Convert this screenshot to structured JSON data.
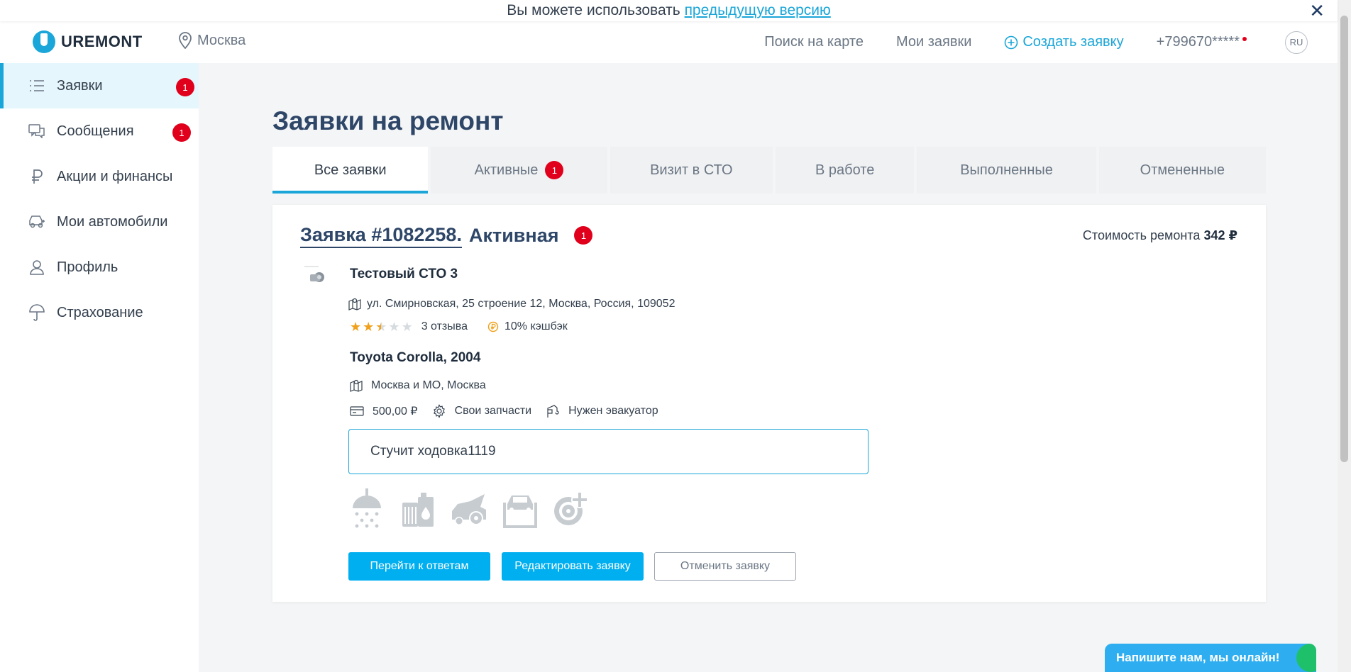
{
  "notice": {
    "text": "Вы можете использовать ",
    "link": "предыдущую версию",
    "close_icon": "close-icon"
  },
  "header": {
    "logo_text": "UREMONT",
    "city": "Москва",
    "nav": {
      "map": "Поиск на карте",
      "my_orders": "Мои заявки",
      "create": "Создать заявку",
      "phone": "+799670*****",
      "lang": "RU"
    }
  },
  "sidebar": {
    "items": [
      {
        "label": "Заявки",
        "icon": "list-icon",
        "badge": "1",
        "active": true
      },
      {
        "label": "Сообщения",
        "icon": "chat-icon",
        "badge": "1"
      },
      {
        "label": "Акции и финансы",
        "icon": "ruble-icon"
      },
      {
        "label": "Мои автомобили",
        "icon": "car-icon"
      },
      {
        "label": "Профиль",
        "icon": "user-icon"
      },
      {
        "label": "Страхование",
        "icon": "umbrella-icon"
      }
    ]
  },
  "main": {
    "title": "Заявки на ремонт",
    "tabs": [
      {
        "label": "Все заявки",
        "active": true
      },
      {
        "label": "Активные",
        "badge": "1"
      },
      {
        "label": "Визит в СТО"
      },
      {
        "label": "В работе"
      },
      {
        "label": "Выполненные"
      },
      {
        "label": "Отмененные"
      }
    ]
  },
  "order": {
    "number": "Заявка #1082258.",
    "status": "Активная",
    "badge": "1",
    "cost_label": "Стоимость ремонта ",
    "cost_value": "342 ₽",
    "sto_name": "Тестовый СТО 3",
    "address": "ул. Смирновская, 25 строение 12, Москва, Россия, 109052",
    "rating": 2.5,
    "reviews": "3 отзыва",
    "cashback": "10% кэшбэк",
    "car": "Toyota Corolla, 2004",
    "region": "Москва и МО, Москва",
    "price": "500,00 ₽",
    "parts": "Свои запчасти",
    "tow": "Нужен эвакуатор",
    "description": "Стучит ходовка1119",
    "service_icons": [
      "car-wash-icon",
      "oil-change-icon",
      "car-body-icon",
      "lift-icon",
      "tire-service-icon"
    ],
    "buttons": {
      "answers": "Перейти к ответам",
      "edit": "Редактировать заявку",
      "cancel": "Отменить заявку"
    }
  },
  "chat": {
    "label": "Напишите нам, мы онлайн!"
  },
  "colors": {
    "accent": "#1aa6d8",
    "badge": "#e0001b",
    "title": "#2e4668",
    "star": "#f0a01a"
  }
}
